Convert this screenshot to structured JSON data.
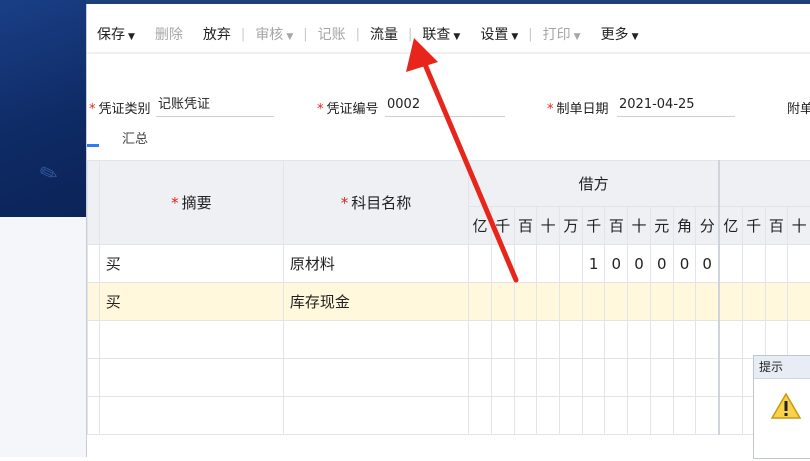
{
  "toolbar": {
    "save": "保存",
    "delete": "删除",
    "discard": "放弃",
    "audit": "审核",
    "post": "记账",
    "cashflow": "流量",
    "query": "联查",
    "settings": "设置",
    "print": "打印",
    "more": "更多"
  },
  "header_fields": {
    "voucher_type_label": "凭证类别",
    "voucher_type_value": "记账凭证",
    "voucher_no_label": "凭证编号",
    "voucher_no_value": "0002",
    "date_label": "制单日期",
    "date_value": "2021-04-25",
    "attachment_label": "附单"
  },
  "tabs": {
    "summary": "汇总"
  },
  "grid": {
    "headers": {
      "summary": "摘要",
      "account": "科目名称",
      "debit": "借方",
      "required_mark": "*"
    },
    "debit_digits": [
      "亿",
      "千",
      "百",
      "十",
      "万",
      "千",
      "百",
      "十",
      "元",
      "角",
      "分"
    ],
    "credit_digits": [
      "亿",
      "千",
      "百",
      "十"
    ],
    "rows": [
      {
        "summary": "买",
        "account": "原材料",
        "debit_digits": [
          "",
          "",
          "",
          "",
          "",
          "1",
          "0",
          "0",
          "0",
          "0",
          "0"
        ]
      },
      {
        "summary": "买",
        "account": "库存现金",
        "debit_digits": [
          "",
          "",
          "",
          "",
          "",
          "",
          "",
          "",
          "",
          "",
          ""
        ]
      },
      {
        "summary": "",
        "account": "",
        "debit_digits": [
          "",
          "",
          "",
          "",
          "",
          "",
          "",
          "",
          "",
          "",
          ""
        ]
      },
      {
        "summary": "",
        "account": "",
        "debit_digits": [
          "",
          "",
          "",
          "",
          "",
          "",
          "",
          "",
          "",
          "",
          ""
        ]
      },
      {
        "summary": "",
        "account": "",
        "debit_digits": [
          "",
          "",
          "",
          "",
          "",
          "",
          "",
          "",
          "",
          "",
          ""
        ]
      }
    ]
  },
  "tip": {
    "title": "提示"
  }
}
